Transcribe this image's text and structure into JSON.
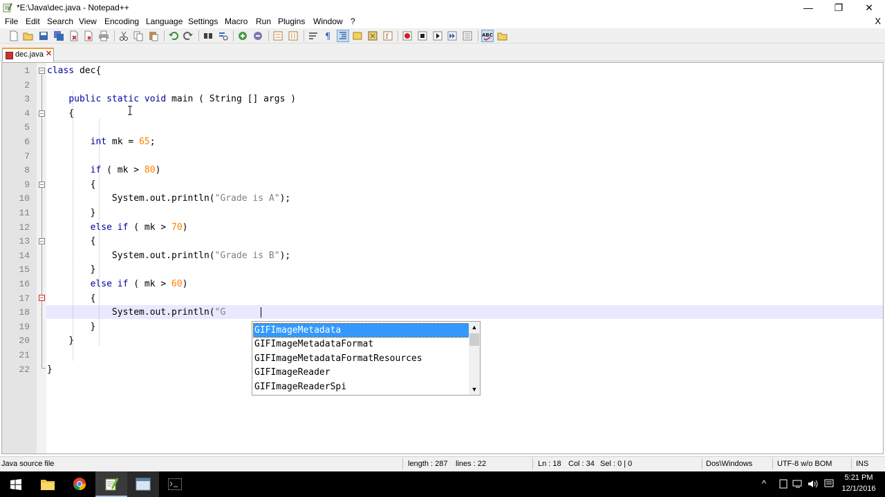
{
  "window": {
    "title": "*E:\\Java\\dec.java - Notepad++",
    "minimize_glyph": "—",
    "restore_glyph": "❐",
    "close_glyph": "✕"
  },
  "menu": {
    "items": [
      "File",
      "Edit",
      "Search",
      "View",
      "Encoding",
      "Language",
      "Settings",
      "Macro",
      "Run",
      "Plugins",
      "Window",
      "?"
    ],
    "close_x": "X"
  },
  "toolbar": {
    "icons": [
      "new-file-icon",
      "open-file-icon",
      "save-icon",
      "save-all-icon",
      "close-icon",
      "close-all-icon",
      "print-icon",
      "cut-icon",
      "copy-icon",
      "paste-icon",
      "undo-icon",
      "redo-icon",
      "find-icon",
      "replace-icon",
      "zoom-in-icon",
      "zoom-out-icon",
      "sync-vertical-icon",
      "sync-horizontal-icon",
      "word-wrap-icon",
      "show-all-chars-icon",
      "indent-guide-icon",
      "language-udl-icon",
      "doc-map-icon",
      "function-list-icon",
      "record-macro-icon",
      "stop-macro-icon",
      "play-macro-icon",
      "run-macro-multiple-icon",
      "save-macro-icon",
      "spell-check-icon",
      "folder-as-workspace-icon"
    ]
  },
  "tab": {
    "label": "dec.java",
    "close_glyph": "✕"
  },
  "editor": {
    "lines": [
      {
        "num": "1",
        "code": [
          [
            "kw",
            "class"
          ],
          [
            "",
            " dec{"
          ]
        ]
      },
      {
        "num": "2",
        "code": []
      },
      {
        "num": "3",
        "code": [
          [
            "",
            "    "
          ],
          [
            "kw",
            "public"
          ],
          [
            "",
            " "
          ],
          [
            "kw",
            "static"
          ],
          [
            "",
            " "
          ],
          [
            "kw",
            "void"
          ],
          [
            "",
            " main ( String [] args )"
          ]
        ]
      },
      {
        "num": "4",
        "code": [
          [
            "",
            "    {"
          ]
        ]
      },
      {
        "num": "5",
        "code": []
      },
      {
        "num": "6",
        "code": [
          [
            "",
            "        "
          ],
          [
            "kw",
            "int"
          ],
          [
            "",
            " mk = "
          ],
          [
            "num",
            "65"
          ],
          [
            "",
            ";"
          ]
        ]
      },
      {
        "num": "7",
        "code": []
      },
      {
        "num": "8",
        "code": [
          [
            "",
            "        "
          ],
          [
            "kw",
            "if"
          ],
          [
            "",
            " ( mk > "
          ],
          [
            "num",
            "80"
          ],
          [
            "",
            ")"
          ]
        ]
      },
      {
        "num": "9",
        "code": [
          [
            "",
            "        {"
          ]
        ]
      },
      {
        "num": "10",
        "code": [
          [
            "",
            "            System.out.println("
          ],
          [
            "str",
            "\"Grade is A\""
          ],
          [
            "",
            ");"
          ]
        ]
      },
      {
        "num": "11",
        "code": [
          [
            "",
            "        }"
          ]
        ]
      },
      {
        "num": "12",
        "code": [
          [
            "",
            "        "
          ],
          [
            "kw",
            "else"
          ],
          [
            "",
            " "
          ],
          [
            "kw",
            "if"
          ],
          [
            "",
            " ( mk > "
          ],
          [
            "num",
            "70"
          ],
          [
            "",
            ")"
          ]
        ]
      },
      {
        "num": "13",
        "code": [
          [
            "",
            "        {"
          ]
        ]
      },
      {
        "num": "14",
        "code": [
          [
            "",
            "            System.out.println("
          ],
          [
            "str",
            "\"Grade is B\""
          ],
          [
            "",
            ");"
          ]
        ]
      },
      {
        "num": "15",
        "code": [
          [
            "",
            "        }"
          ]
        ]
      },
      {
        "num": "16",
        "code": [
          [
            "",
            "        "
          ],
          [
            "kw",
            "else"
          ],
          [
            "",
            " "
          ],
          [
            "kw",
            "if"
          ],
          [
            "",
            " ( mk > "
          ],
          [
            "num",
            "60"
          ],
          [
            "",
            ")"
          ]
        ]
      },
      {
        "num": "17",
        "code": [
          [
            "",
            "        {"
          ]
        ]
      },
      {
        "num": "18",
        "code": [
          [
            "",
            "            System.out.println("
          ],
          [
            "str",
            "\"G"
          ]
        ]
      },
      {
        "num": "19",
        "code": [
          [
            "",
            "        }"
          ]
        ]
      },
      {
        "num": "20",
        "code": [
          [
            "",
            "    }"
          ]
        ]
      },
      {
        "num": "21",
        "code": []
      },
      {
        "num": "22",
        "code": [
          [
            "",
            "}"
          ]
        ]
      }
    ]
  },
  "autocomplete": {
    "items": [
      "GIFImageMetadata",
      "GIFImageMetadataFormat",
      "GIFImageMetadataFormatResources",
      "GIFImageReader",
      "GIFImageReaderSpi"
    ],
    "selected": 0,
    "up_glyph": "▲",
    "down_glyph": "▼"
  },
  "status": {
    "file_type": "Java source file",
    "length": "length : 287",
    "lines": "lines : 22",
    "ln": "Ln : 18",
    "col": "Col : 34",
    "sel": "Sel : 0 | 0",
    "eol": "Dos\\Windows",
    "encoding": "UTF-8 w/o BOM",
    "mode": "INS"
  },
  "taskbar": {
    "clock_time": "5:21 PM",
    "clock_date": "12/1/2016",
    "tray_icons": [
      "chevron-up-icon",
      "tablet-icon",
      "network-icon",
      "volume-icon",
      "action-center-icon"
    ],
    "apps": [
      "start-icon",
      "file-explorer-icon",
      "chrome-icon",
      "notepadpp-icon",
      "window-app-icon",
      "command-prompt-icon"
    ]
  },
  "colors": {
    "keyword": "#0000a0",
    "number": "#ff8000",
    "string": "#808080",
    "selection": "#3399ff",
    "current_line": "#e8e8ff"
  }
}
